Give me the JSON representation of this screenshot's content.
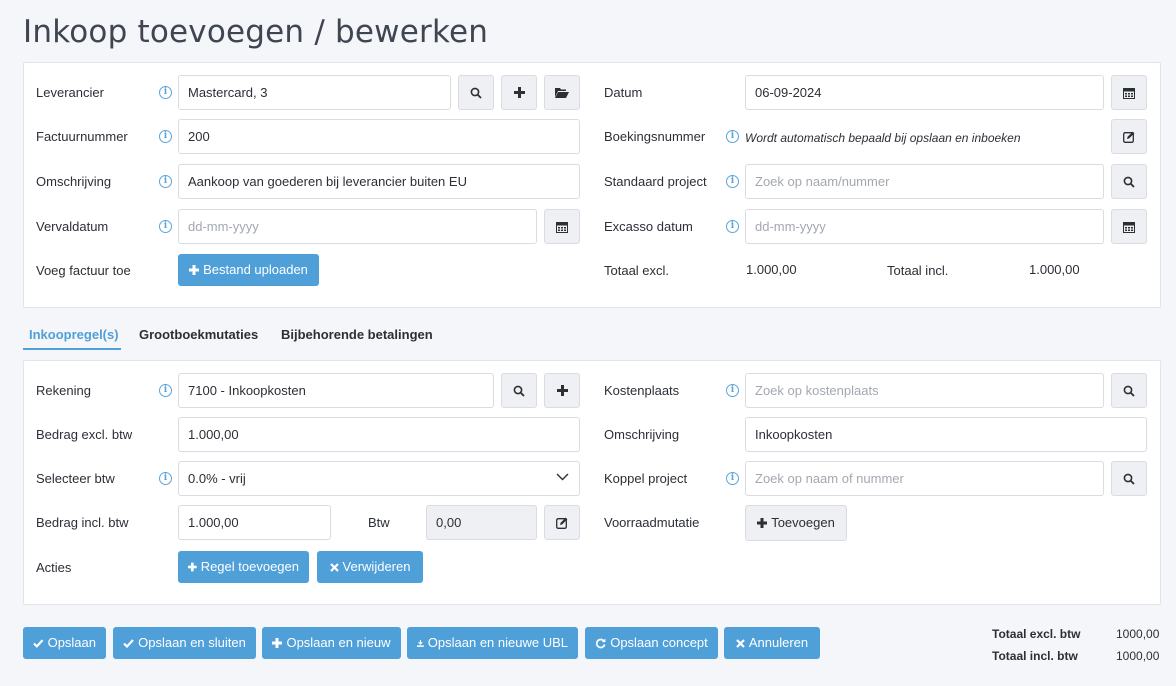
{
  "page": {
    "title": "Inkoop toevoegen / bewerken"
  },
  "header": {
    "leverancier": {
      "label": "Leverancier",
      "value": "Mastercard, 3"
    },
    "factuurnummer": {
      "label": "Factuurnummer",
      "value": "200"
    },
    "omschrijving": {
      "label": "Omschrijving",
      "value": "Aankoop van goederen bij leverancier buiten EU"
    },
    "vervaldatum": {
      "label": "Vervaldatum",
      "placeholder": "dd-mm-yyyy"
    },
    "voeg_factuur": {
      "label": "Voeg factuur toe",
      "button": "Bestand uploaden"
    },
    "datum": {
      "label": "Datum",
      "value": "06-09-2024"
    },
    "boekingsnummer": {
      "label": "Boekingsnummer",
      "note": "Wordt automatisch bepaald bij opslaan en inboeken"
    },
    "standaard_project": {
      "label": "Standaard project",
      "placeholder": "Zoek op naam/nummer"
    },
    "excasso_datum": {
      "label": "Excasso datum",
      "placeholder": "dd-mm-yyyy"
    },
    "totaal_excl": {
      "label": "Totaal excl.",
      "value": "1.000,00"
    },
    "totaal_incl": {
      "label": "Totaal incl.",
      "value": "1.000,00"
    }
  },
  "tabs": [
    {
      "label": "Inkoopregel(s)",
      "active": true
    },
    {
      "label": "Grootboekmutaties",
      "active": false
    },
    {
      "label": "Bijbehorende betalingen",
      "active": false
    }
  ],
  "line": {
    "rekening": {
      "label": "Rekening",
      "value": "7100 - Inkoopkosten"
    },
    "bedrag_excl": {
      "label": "Bedrag excl. btw",
      "value": "1.000,00"
    },
    "selecteer_btw": {
      "label": "Selecteer btw",
      "value": "0.0% - vrij"
    },
    "bedrag_incl": {
      "label": "Bedrag incl. btw",
      "value": "1.000,00"
    },
    "btw": {
      "label": "Btw",
      "value": "0,00"
    },
    "acties": {
      "label": "Acties",
      "add": "Regel toevoegen",
      "remove": "Verwijderen"
    },
    "kostenplaats": {
      "label": "Kostenplaats",
      "placeholder": "Zoek op kostenplaats"
    },
    "omschrijving": {
      "label": "Omschrijving",
      "value": "Inkoopkosten"
    },
    "koppel_project": {
      "label": "Koppel project",
      "placeholder": "Zoek op naam of nummer"
    },
    "voorraadmutatie": {
      "label": "Voorraadmutatie",
      "button": "Toevoegen"
    }
  },
  "footer": {
    "buttons": {
      "opslaan": "Opslaan",
      "opslaan_sluiten": "Opslaan en sluiten",
      "opslaan_nieuw": "Opslaan en nieuw",
      "opslaan_ubl": "Opslaan en nieuwe UBL",
      "opslaan_concept": "Opslaan concept",
      "annuleren": "Annuleren"
    },
    "totaal_excl_label": "Totaal excl. btw",
    "totaal_excl_value": "1000,00",
    "totaal_incl_label": "Totaal incl. btw",
    "totaal_incl_value": "1000,00"
  },
  "icons": {
    "info": "i"
  },
  "colors": {
    "accent": "#4f9fd9",
    "info": "#5aa5d9"
  }
}
